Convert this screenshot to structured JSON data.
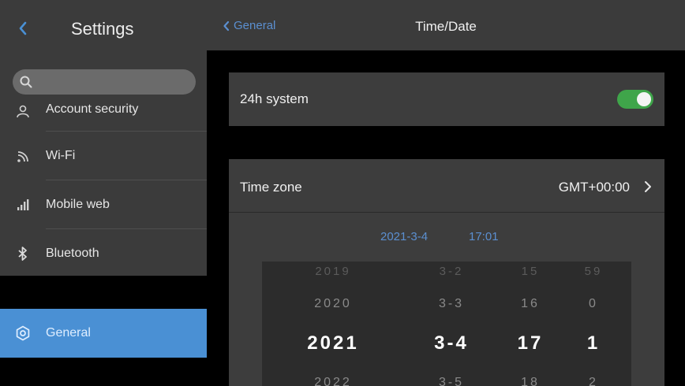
{
  "sidebar": {
    "title": "Settings",
    "search_placeholder": "",
    "items": [
      {
        "label": "Account security",
        "icon": "user-icon"
      },
      {
        "label": "Wi-Fi",
        "icon": "wifi-icon"
      },
      {
        "label": "Mobile web",
        "icon": "signal-icon"
      },
      {
        "label": "Bluetooth",
        "icon": "bluetooth-icon"
      },
      {
        "label": "General",
        "icon": "gear-icon",
        "selected": true
      }
    ]
  },
  "header": {
    "back_label": "General",
    "title": "Time/Date"
  },
  "settings": {
    "h24_label": "24h system",
    "h24_enabled": true,
    "timezone_label": "Time zone",
    "timezone_value": "GMT+00:00",
    "selected_date": "2021-3-4",
    "selected_time": "17:01"
  },
  "picker": {
    "rows": [
      {
        "state": "faded",
        "year": "2019",
        "date": "3-2",
        "hour": "15",
        "minute": "59"
      },
      {
        "state": "near",
        "year": "2020",
        "date": "3-3",
        "hour": "16",
        "minute": "0"
      },
      {
        "state": "active",
        "year": "2021",
        "date": "3-4",
        "hour": "17",
        "minute": "1"
      },
      {
        "state": "near",
        "year": "2022",
        "date": "3-5",
        "hour": "18",
        "minute": "2"
      }
    ]
  },
  "colors": {
    "accent": "#4a90d4",
    "link": "#5b8fd0",
    "toggle_on": "#3fa54a",
    "panel": "#3b3b3b",
    "background": "#000000"
  }
}
